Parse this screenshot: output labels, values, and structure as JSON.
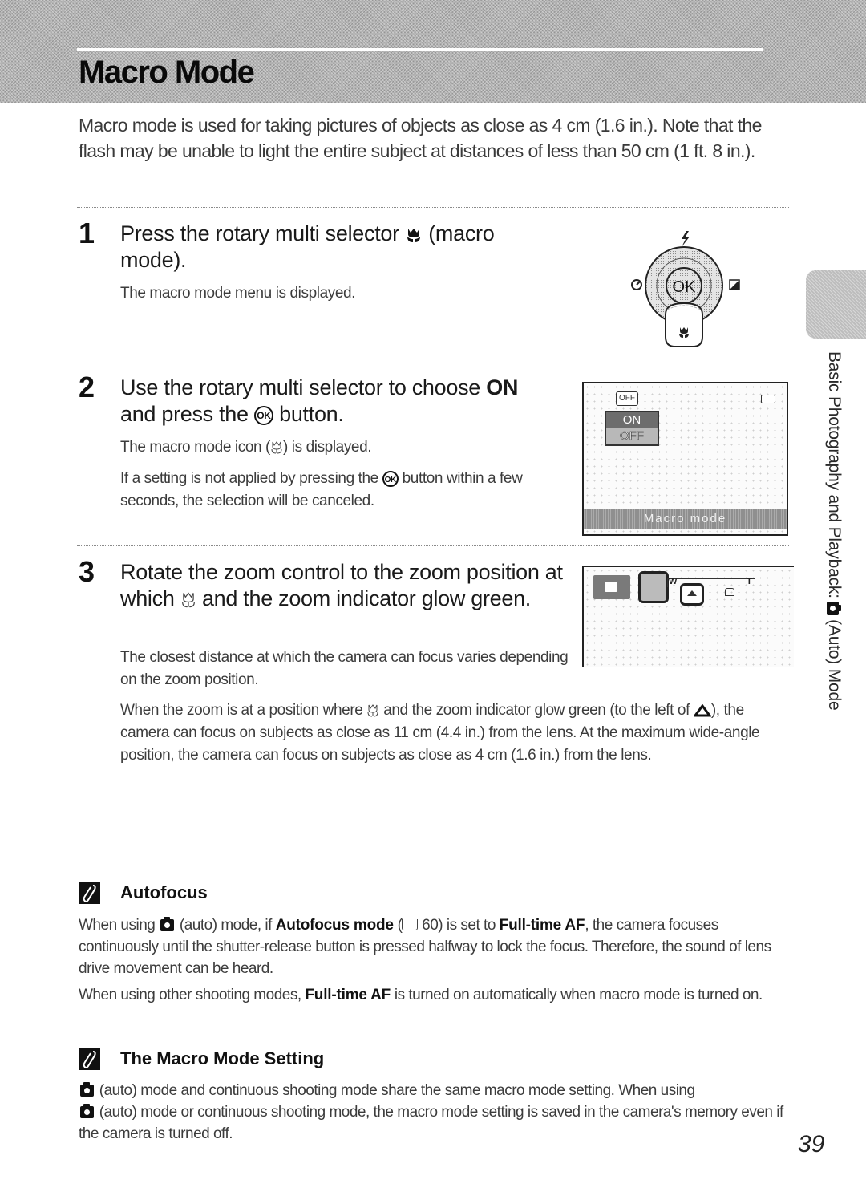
{
  "header": {
    "title": "Macro Mode"
  },
  "intro": "Macro mode is used for taking pictures of objects as close as 4 cm (1.6 in.). Note that the flash may be unable to light the entire subject at distances of less than 50 cm (1 ft. 8 in.).",
  "steps": [
    {
      "number": "1",
      "title_before": "Press the rotary multi selector",
      "title_icon": "macro-flower-icon",
      "title_after": "(macro mode).",
      "notes": [
        "The macro mode menu is displayed."
      ],
      "figure": {
        "type": "rotary-multi-selector",
        "center_label": "OK",
        "icons": {
          "top": "flash-icon",
          "left": "self-timer-icon",
          "right": "exposure-compensation-icon",
          "bottom": "macro-flower-icon"
        }
      }
    },
    {
      "number": "2",
      "title_before": "Use the rotary multi selector to choose",
      "title_bold": "ON",
      "title_mid": "and press the",
      "title_icon": "ok-button-icon",
      "title_after": "button.",
      "notes": [
        "The macro mode icon (",
        ") is displayed.",
        "If a setting is not applied by pressing the",
        "button within a few seconds, the selection will be canceled."
      ],
      "figure": {
        "type": "lcd-menu",
        "top_icon_label": "OFF",
        "menu_options": [
          "ON",
          "OFF"
        ],
        "selected_option": "ON",
        "bottom_bar": "Macro mode"
      }
    },
    {
      "number": "3",
      "title_before": "Rotate the zoom control to the zoom position at which",
      "title_icon": "macro-outline-icon",
      "title_after": "and the zoom indicator glow green.",
      "notes": [
        "The closest distance at which the camera can focus varies depending on the zoom position."
      ],
      "figure": {
        "type": "lcd-zoom",
        "zoom_labels": {
          "wide": "W",
          "tele": "T"
        }
      }
    }
  ],
  "step3_extra": {
    "part1": "When the zoom is at a position where",
    "part2": "and the zoom indicator glow green (to the left of",
    "part3": "), the camera can focus on subjects as close as 11 cm (4.4 in.) from the lens. At the maximum wide-angle position, the camera can focus on subjects as close as 4 cm (1.6 in.) from the lens."
  },
  "notes": [
    {
      "title": "Autofocus",
      "paragraphs": [
        {
          "p1": "When using",
          "p2": "(auto) mode, if",
          "b1": "Autofocus mode",
          "p3": "(",
          "p4": "60) is set to",
          "b2": "Full-time AF",
          "p5": ", the camera focuses continuously until the shutter-release button is pressed halfway to lock the focus. Therefore, the sound of lens drive movement can be heard."
        },
        {
          "p1": "When using other shooting modes,",
          "b1": "Full-time AF",
          "p2": "is turned on automatically when macro mode is turned on."
        }
      ]
    },
    {
      "title": "The Macro Mode Setting",
      "paragraphs": [
        {
          "p1": "(auto) mode and continuous shooting mode share the same macro mode setting. When using"
        },
        {
          "p1": "(auto) mode or continuous shooting mode, the macro mode setting is saved in the camera's memory even if the camera is turned off."
        }
      ]
    }
  ],
  "sidebar": {
    "label_before": "Basic Photography and Playback:",
    "label_after": "(Auto) Mode"
  },
  "page_number": "39"
}
